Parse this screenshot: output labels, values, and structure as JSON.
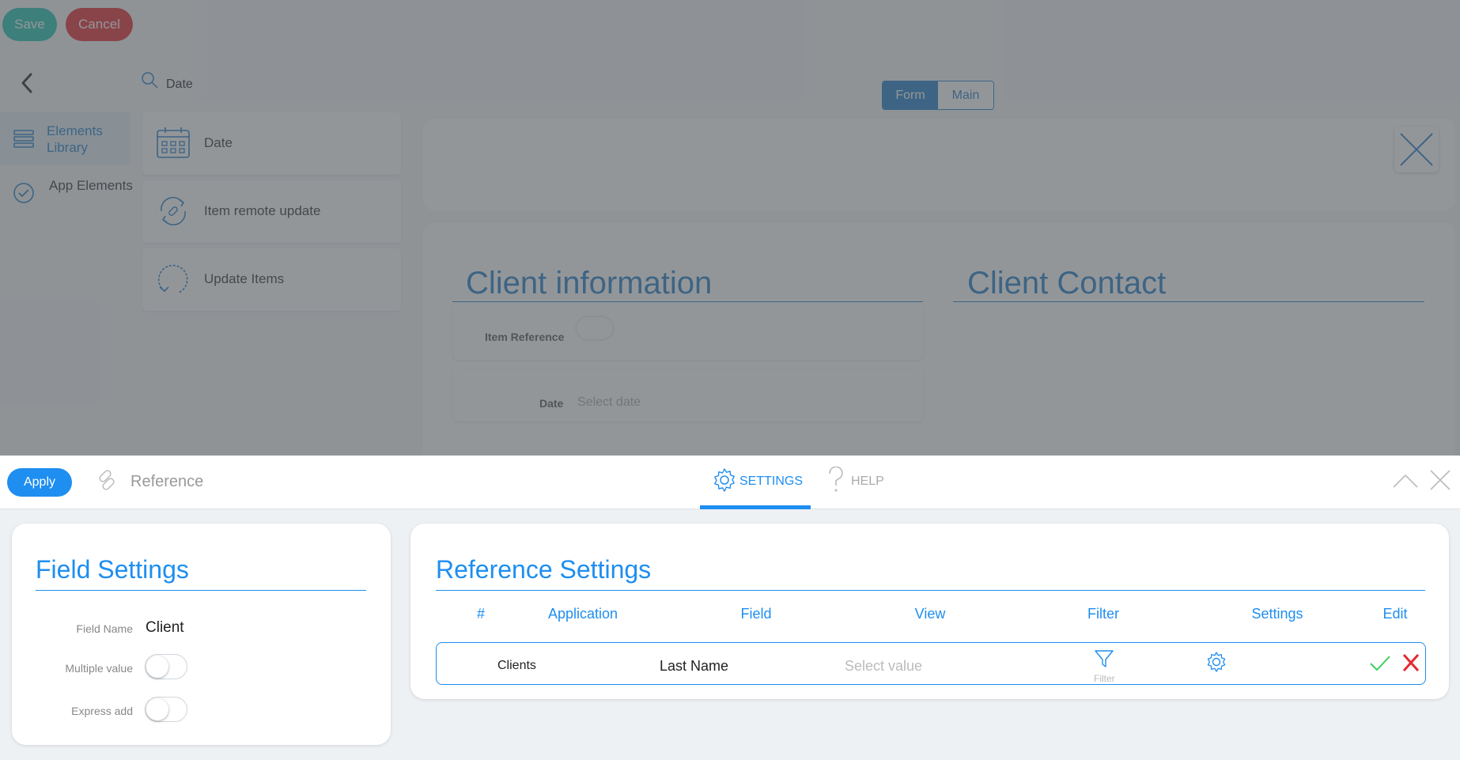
{
  "toolbar": {
    "save_label": "Save",
    "cancel_label": "Cancel"
  },
  "sidebar": {
    "items": [
      {
        "label": "Elements Library",
        "icon": "stack-icon",
        "active": true
      },
      {
        "label": "App Elements",
        "icon": "check-circle-icon",
        "active": false
      }
    ]
  },
  "library": {
    "search_value": "Date",
    "elements": [
      {
        "label": "Date",
        "icon": "calendar-icon"
      },
      {
        "label": "Item remote update",
        "icon": "link-refresh-icon"
      },
      {
        "label": "Update Items",
        "icon": "refresh-icon"
      }
    ]
  },
  "view_toggle": {
    "options": [
      "Form",
      "Main"
    ],
    "selected": "Form"
  },
  "form": {
    "sections": [
      {
        "title": "Client information"
      },
      {
        "title": "Client Contact"
      }
    ],
    "fields": [
      {
        "label": "Item Reference"
      },
      {
        "label": "Date",
        "placeholder": "Select date"
      }
    ]
  },
  "settings_bar": {
    "apply_label": "Apply",
    "element_type": "Reference",
    "tabs": [
      {
        "label": "SETTINGS",
        "active": true
      },
      {
        "label": "HELP",
        "active": false
      }
    ]
  },
  "field_settings": {
    "title": "Field Settings",
    "field_name_label": "Field Name",
    "field_name_value": "Client",
    "multiple_value_label": "Multiple value",
    "multiple_value_on": false,
    "express_add_label": "Express add",
    "express_add_on": false
  },
  "reference_settings": {
    "title": "Reference Settings",
    "columns": [
      "#",
      "Application",
      "Field",
      "View",
      "Filter",
      "Settings",
      "Edit"
    ],
    "row": {
      "application": "Clients",
      "field": "Last Name",
      "view_placeholder": "Select value",
      "filter_label": "Filter"
    }
  },
  "colors": {
    "accent": "#1e8ef0",
    "save": "#1ec3ad",
    "cancel": "#e5292f",
    "confirm": "#3ccf5a"
  }
}
